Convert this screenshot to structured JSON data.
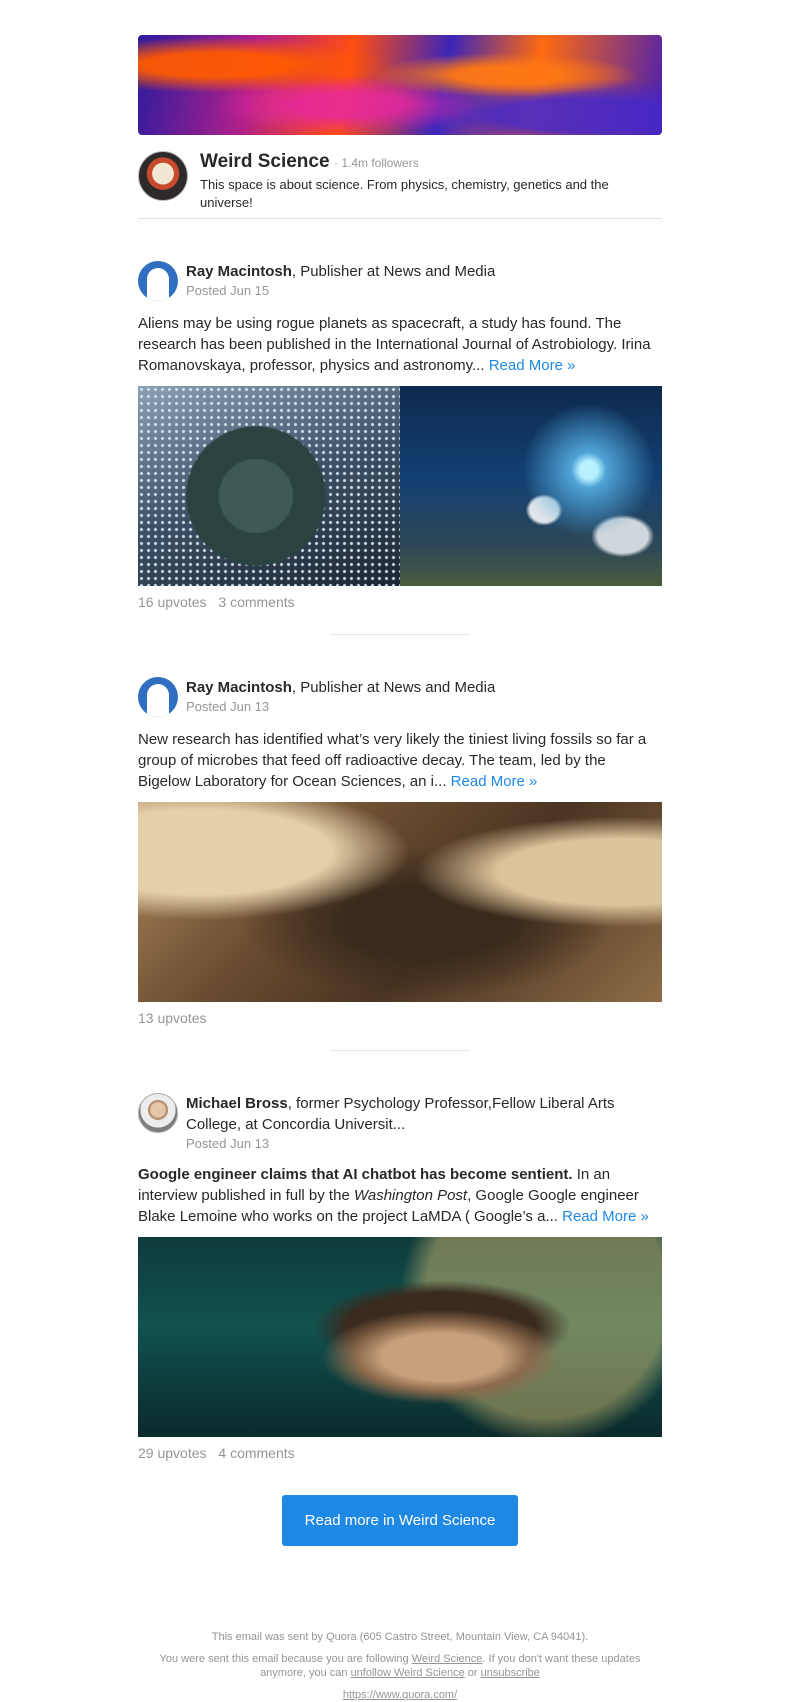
{
  "space": {
    "name": "Weird Science",
    "followers": "· 1.4m followers",
    "description": "This space is about science. From physics, chemistry, genetics and the universe!"
  },
  "posts": [
    {
      "author": "Ray Macintosh",
      "credential": ", Publisher at News and Media",
      "date": "Posted Jun 15",
      "body": "Aliens may be using rogue planets as spacecraft, a study has found. The research has been published in the International Journal of Astrobiology. Irina Romanovskaya, professor, physics and astronomy...",
      "read_more": "Read More »",
      "upvotes": "16 upvotes",
      "comments": "3 comments"
    },
    {
      "author": "Ray Macintosh",
      "credential": ", Publisher at News and Media",
      "date": "Posted Jun 13",
      "body": "New research has identified what’s very likely the tiniest living fossils so far a group of microbes that feed off radioactive decay. The team, led by the Bigelow Laboratory for Ocean Sciences, an i...",
      "read_more": "Read More »",
      "upvotes": "13 upvotes"
    },
    {
      "author": "Michael Bross",
      "credential": ", former Psychology Professor,Fellow Liberal Arts College, at Concordia Universit...",
      "date": "Posted Jun 13",
      "body_bold": "Google engineer claims that AI chatbot has become sentient.",
      "body_part1": " In an interview published in full by the ",
      "body_italic": "Washington Post",
      "body_part2": ", Google Google engineer Blake Lemoine who works on the project LaMDA ( Google’s a...",
      "read_more": "Read More »",
      "upvotes": "29 upvotes",
      "comments": "4 comments"
    }
  ],
  "cta": {
    "label": "Read more in Weird Science"
  },
  "footer": {
    "sent_by": "This email was sent by Quora (605 Castro Street, Mountain View, CA 94041).",
    "reason_part1": "You were sent this email because you are following ",
    "reason_link": "Weird Science",
    "reason_part2": ". If you don't want these updates",
    "reason_part3": "anymore, you can ",
    "unfollow_link": "unfollow Weird Science",
    "reason_or": " or ",
    "unsubscribe_link": "unsubscribe",
    "site_url": "https://www.quora.com/"
  },
  "colors": {
    "accent": "#1e88e5",
    "muted": "#939598",
    "text": "#282829"
  },
  "icons": {
    "space_avatar": "einstein-portrait",
    "author_avatar": "blue-silhouette"
  }
}
